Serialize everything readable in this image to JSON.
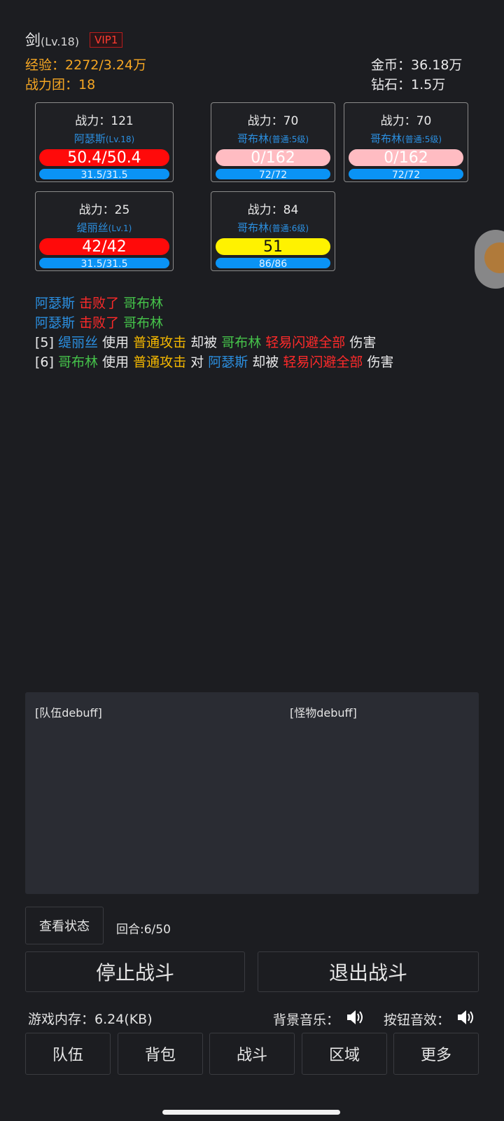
{
  "header": {
    "name": "剑",
    "level": "(Lv.18)",
    "vip": "VIP1",
    "exp_label": "经验：",
    "exp_value": "2272/3.24万",
    "team_label": "战力团：",
    "team_value": "18",
    "gold_label": "金币：",
    "gold_value": "36.18万",
    "diamond_label": "钻石：",
    "diamond_value": "1.5万"
  },
  "cards": [
    {
      "power": "战力：121",
      "name": "阿瑟斯",
      "sub": "(Lv.18)",
      "hp": "50.4/50.4",
      "hp_fraction": 1.0,
      "mp": "31.5/31.5"
    },
    {
      "power": "战力：70",
      "name": "哥布林",
      "sub": "(普通:5级)",
      "hp": "0/162",
      "hp_fraction": 0.0,
      "mp": "72/72"
    },
    {
      "power": "战力：70",
      "name": "哥布林",
      "sub": "(普通:5级)",
      "hp": "0/162",
      "hp_fraction": 0.0,
      "mp": "72/72"
    },
    {
      "power": "战力：25",
      "name": "缇丽丝",
      "sub": "(Lv.1)",
      "hp": "42/42",
      "hp_fraction": 1.0,
      "mp": "31.5/31.5"
    },
    {
      "power": "战力：84",
      "name": "哥布林",
      "sub": "(普通:6级)",
      "hp": "51",
      "mp": "86/86"
    }
  ],
  "log": [
    {
      "a": "阿瑟斯",
      "b": "击败了",
      "c": "哥布林"
    },
    {
      "a": "阿瑟斯",
      "b": "击败了",
      "c": "哥布林"
    },
    {
      "idx": "[5]",
      "actor": "缇丽丝",
      "use": "使用",
      "skill": "普通攻击",
      "but": "却被",
      "target": "哥布林",
      "effect": "轻易闪避全部",
      "dmg": "伤害"
    },
    {
      "idx": "[6]",
      "actor": "哥布林",
      "use": "使用",
      "skill": "普通攻击",
      "to": "对",
      "target": "阿瑟斯",
      "but": "却被",
      "effect": "轻易闪避全部",
      "dmg": "伤害"
    }
  ],
  "debuff": {
    "team_label": "[队伍debuff]",
    "monster_label": "[怪物debuff]"
  },
  "controls": {
    "status_button": "查看状态",
    "round": "回合:6/50",
    "stop_button": "停止战斗",
    "exit_button": "退出战斗"
  },
  "footer": {
    "memory": "游戏内存：6.24(KB)",
    "bgm_label": "背景音乐：",
    "sfx_label": "按钮音效："
  },
  "nav": [
    "队伍",
    "背包",
    "战斗",
    "区域",
    "更多"
  ],
  "colors": {
    "background": "#1c1d21",
    "accent_orange": "#f5a623",
    "hp_red": "#ff0a0a",
    "hp_empty": "#ffbcc2",
    "hp_yellow": "#fff200",
    "mp_blue": "#0a93f5",
    "name_blue": "#2b8fe0",
    "log_red": "#ff2a2a",
    "log_green": "#45c24a",
    "log_yellow": "#f5b800"
  },
  "icons": [
    "speaker-icon",
    "speaker-icon"
  ]
}
